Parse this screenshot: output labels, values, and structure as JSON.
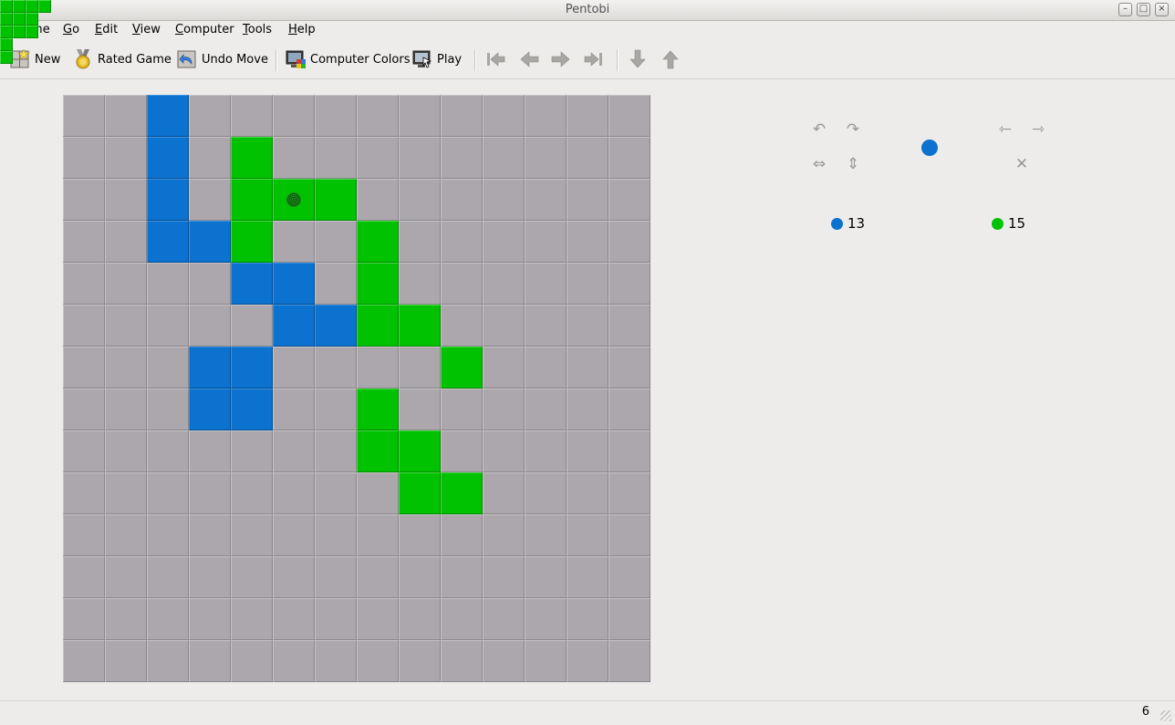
{
  "window": {
    "title": "Pentobi"
  },
  "menu": [
    {
      "key": "G",
      "rest": "ame"
    },
    {
      "key": "G",
      "rest": "o"
    },
    {
      "key": "E",
      "rest": "dit"
    },
    {
      "key": "V",
      "rest": "iew"
    },
    {
      "key": "C",
      "rest": "omputer"
    },
    {
      "key": "T",
      "rest": "ools"
    },
    {
      "key": "H",
      "rest": "elp"
    }
  ],
  "toolbar": {
    "new_label": "New",
    "rated_label": "Rated Game",
    "undo_label": "Undo Move",
    "computer_colors_label": "Computer Colors",
    "play_label": "Play"
  },
  "colors": {
    "blue": "#0b72cf",
    "green": "#00c200",
    "empty": "#aca7ac"
  },
  "board": {
    "size": 14,
    "rows": [
      "..b...........",
      "..b.g.........",
      "..b.ggg.......",
      "..bbg..g......",
      "....bb.g......",
      ".....bbgg.....",
      "...bb....g....",
      "...bb..g......",
      ".......gg.....",
      "........gg....",
      "..............",
      "..............",
      "..............",
      ".............."
    ],
    "last_move": {
      "row": 2,
      "col": 5
    }
  },
  "current_player": "blue",
  "scores": {
    "blue": "13",
    "green": "15"
  },
  "piece_shapes": [
    [
      "#"
    ],
    [
      "##"
    ],
    [
      "###"
    ],
    [
      "#.",
      "##"
    ],
    [
      "####"
    ],
    [
      "##",
      ".#",
      "##"
    ],
    [
      "##",
      "#.",
      "##"
    ],
    [
      "..#",
      "###"
    ],
    [
      "##.",
      ".##"
    ],
    [
      "#..",
      "###"
    ],
    [
      ".#.",
      "###"
    ],
    [
      "###",
      ".#.",
      ".#."
    ],
    [
      "#..",
      "##.",
      ".##"
    ],
    [
      ".#.",
      "###",
      ".#."
    ],
    [
      "#",
      "#",
      "#",
      "#",
      "#"
    ]
  ]
}
